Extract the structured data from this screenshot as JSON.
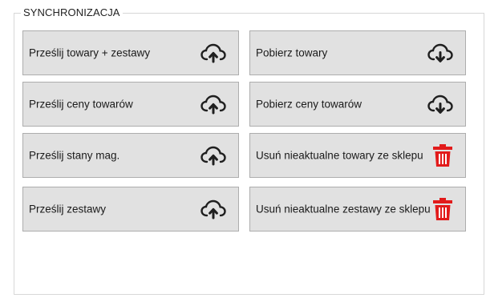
{
  "sync": {
    "title": "SYNCHRONIZACJA",
    "left_buttons": [
      {
        "label": "Prześlij towary + zestawy",
        "icon": "cloud-upload-icon"
      },
      {
        "label": "Prześlij ceny towarów",
        "icon": "cloud-upload-icon"
      },
      {
        "label": "Prześlij stany mag.",
        "icon": "cloud-upload-icon"
      },
      {
        "label": "Prześlij zestawy",
        "icon": "cloud-upload-icon"
      }
    ],
    "right_buttons": [
      {
        "label": "Pobierz towary",
        "icon": "cloud-download-icon"
      },
      {
        "label": "Pobierz ceny towarów",
        "icon": "cloud-download-icon"
      },
      {
        "label": "Usuń nieaktualne towary ze sklepu",
        "icon": "trash-icon"
      },
      {
        "label": "Usuń nieaktualne zestawy ze sklepu",
        "icon": "trash-icon"
      }
    ]
  },
  "colors": {
    "button_bg": "#e1e1e1",
    "button_border": "#adadad",
    "trash_red": "#e21b1b",
    "icon_dark": "#1f1f1f"
  }
}
